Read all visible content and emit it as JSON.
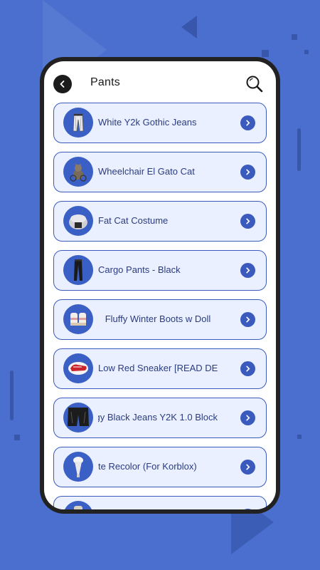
{
  "header": {
    "title": "Pants"
  },
  "items": [
    {
      "label": "White Y2k Gothic Jeans",
      "icon": "jeans-icon"
    },
    {
      "label": "Wheelchair El Gato Cat",
      "icon": "cat-icon"
    },
    {
      "label": "Fat Cat Costume",
      "icon": "costume-icon"
    },
    {
      "label": "Cargo Pants - Black",
      "icon": "pants-icon"
    },
    {
      "label": "Fluffy Winter Boots w Doll",
      "icon": "boots-icon"
    },
    {
      "label": "Low Red Sneaker [READ DE",
      "icon": "sneaker-icon"
    },
    {
      "label": "gy Black Jeans Y2K 1.0 Block",
      "icon": "shorts-icon"
    },
    {
      "label": "te Recolor (For Korblox)",
      "icon": "leg-icon"
    },
    {
      "label": "",
      "icon": "item-icon"
    }
  ],
  "colors": {
    "background": "#4a6fce",
    "accent": "#3a5bbd",
    "item_bg": "#eaf0ff",
    "text": "#2b3c80"
  }
}
